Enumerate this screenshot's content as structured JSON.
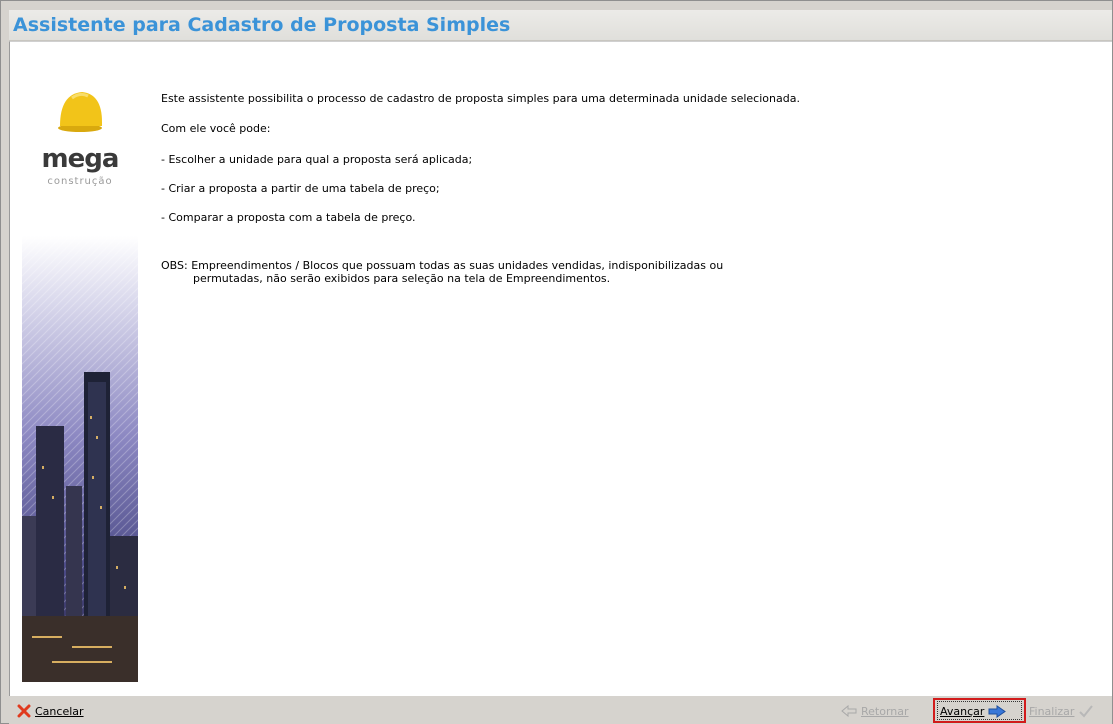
{
  "window": {
    "title": "Assistente para Cadastro de Proposta Simples"
  },
  "logo": {
    "brand": "mega",
    "subtitle": "construção"
  },
  "intro": {
    "line1": "Este assistente possibilita o processo de cadastro de proposta simples para uma determinada unidade selecionada.",
    "line2": "Com ele você pode:",
    "item1": "- Escolher a unidade para qual a proposta será aplicada;",
    "item2": "- Criar a proposta a partir de uma tabela de preço;",
    "item3": "- Comparar a proposta com a tabela de preço.",
    "obs1": "OBS: Empreendimentos / Blocos que possuam todas as suas unidades vendidas, indisponibilizadas ou",
    "obs2": "permutadas, não serão exibidos para seleção na tela de Empreendimentos."
  },
  "footer": {
    "cancel": "Cancelar",
    "back": "Retornar",
    "next": "Avançar",
    "finish": "Finalizar"
  },
  "colors": {
    "title": "#3b93d8",
    "helmet": "#f2c419",
    "highlight": "#d11b1b",
    "arrow": "#3a78d8"
  }
}
